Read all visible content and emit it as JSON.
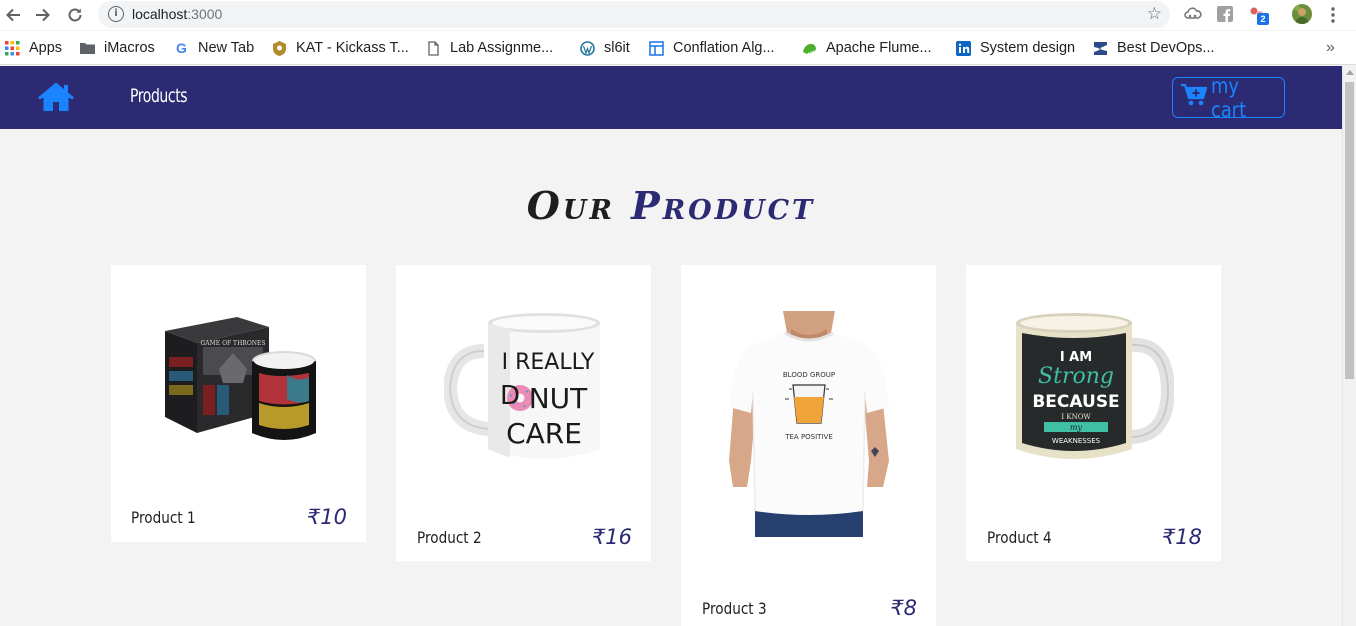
{
  "browser": {
    "url_host": "localhost",
    "url_port": ":3000",
    "extension_badge": "2",
    "bookmarks": [
      {
        "label": "Apps",
        "icon": "apps-grid-icon"
      },
      {
        "label": "iMacros",
        "icon": "folder-icon"
      },
      {
        "label": "New Tab",
        "icon": "google-icon"
      },
      {
        "label": "KAT - Kickass T...",
        "icon": "kat-icon"
      },
      {
        "label": "Lab Assignme...",
        "icon": "page-icon"
      },
      {
        "label": "sl6it",
        "icon": "wordpress-icon"
      },
      {
        "label": "Conflation Alg...",
        "icon": "layout-icon"
      },
      {
        "label": "Apache Flume...",
        "icon": "flume-icon"
      },
      {
        "label": "System design",
        "icon": "linkedin-icon"
      },
      {
        "label": "Best DevOps...",
        "icon": "devops-icon"
      }
    ],
    "more_bookmarks": "»"
  },
  "navbar": {
    "home_icon": "home-icon",
    "products_link": "Products",
    "cart_label": "my cart",
    "cart_icon": "cart-icon",
    "bg_color": "#2b2a73",
    "accent_color": "#1a84ff"
  },
  "page": {
    "heading_word1": "Our",
    "heading_word2": "Product"
  },
  "products": [
    {
      "name": "Product 1",
      "price": "₹10",
      "image": "game-of-thrones-mug-box"
    },
    {
      "name": "Product 2",
      "price": "₹16",
      "image": "donut-care-mug"
    },
    {
      "name": "Product 3",
      "price": "₹8",
      "image": "tea-positive-tshirt"
    },
    {
      "name": "Product 4",
      "price": "₹18",
      "image": "i-am-strong-mug"
    }
  ],
  "mug2_text": [
    "I REALLY",
    "D",
    "NUT",
    "CARE"
  ],
  "mug4_text": [
    "I AM",
    "Strong",
    "BECAUSE",
    "I KNOW",
    "my",
    "WEAKNESSES"
  ],
  "tshirt_text": [
    "BLOOD GROUP",
    "TEA POSITIVE"
  ],
  "box_text": "GAME OF THRONES"
}
